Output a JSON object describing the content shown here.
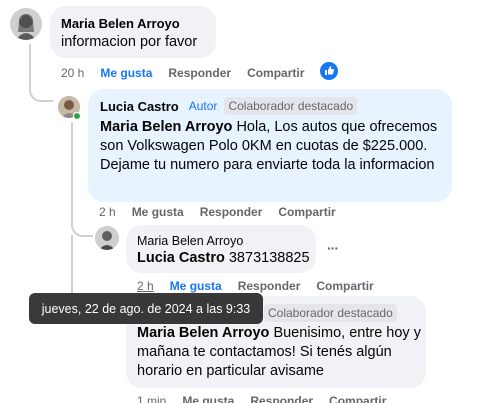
{
  "comments": [
    {
      "author": "Maria Belen Arroyo",
      "text": "informacion por favor",
      "time": "20 h",
      "like": "Me gusta",
      "reply": "Responder",
      "share": "Compartir"
    },
    {
      "author": "Lucia Castro",
      "author_badge": "Autor",
      "badge": "Colaborador destacado",
      "mention": "Maria Belen Arroyo",
      "text": " Hola, Los autos que ofrecemos son Volkswagen Polo 0KM en cuotas de $225.000. Dejame tu numero para enviarte toda la informacion",
      "time": "2 h",
      "like": "Me gusta",
      "reply": "Responder",
      "share": "Compartir"
    },
    {
      "author": "Maria Belen Arroyo",
      "mention": "Lucia Castro",
      "text": " 3873138825",
      "time": "2 h",
      "like": "Me gusta",
      "reply": "Responder",
      "share": "Compartir",
      "more": "···"
    },
    {
      "author": "Lucia Castro",
      "badge": "Colaborador destacado",
      "mention": "Maria Belen Arroyo",
      "text": " Buenisimo, entre hoy y mañana te contactamos! Si tenés algún horario en particular avisame",
      "time": "1 min",
      "like": "Me gusta",
      "reply": "Responder",
      "share": "Compartir"
    }
  ],
  "tooltip": "jueves, 22 de ago. de 2024 a las 9:33",
  "colors": {
    "bubble_gray": "#f0f2f5",
    "bubble_blue": "#e7f3ff",
    "link_blue": "#1877f2",
    "secondary": "#65676b",
    "online": "#31a24c"
  },
  "icons": {
    "like_reaction": "thumbs-up-icon"
  }
}
